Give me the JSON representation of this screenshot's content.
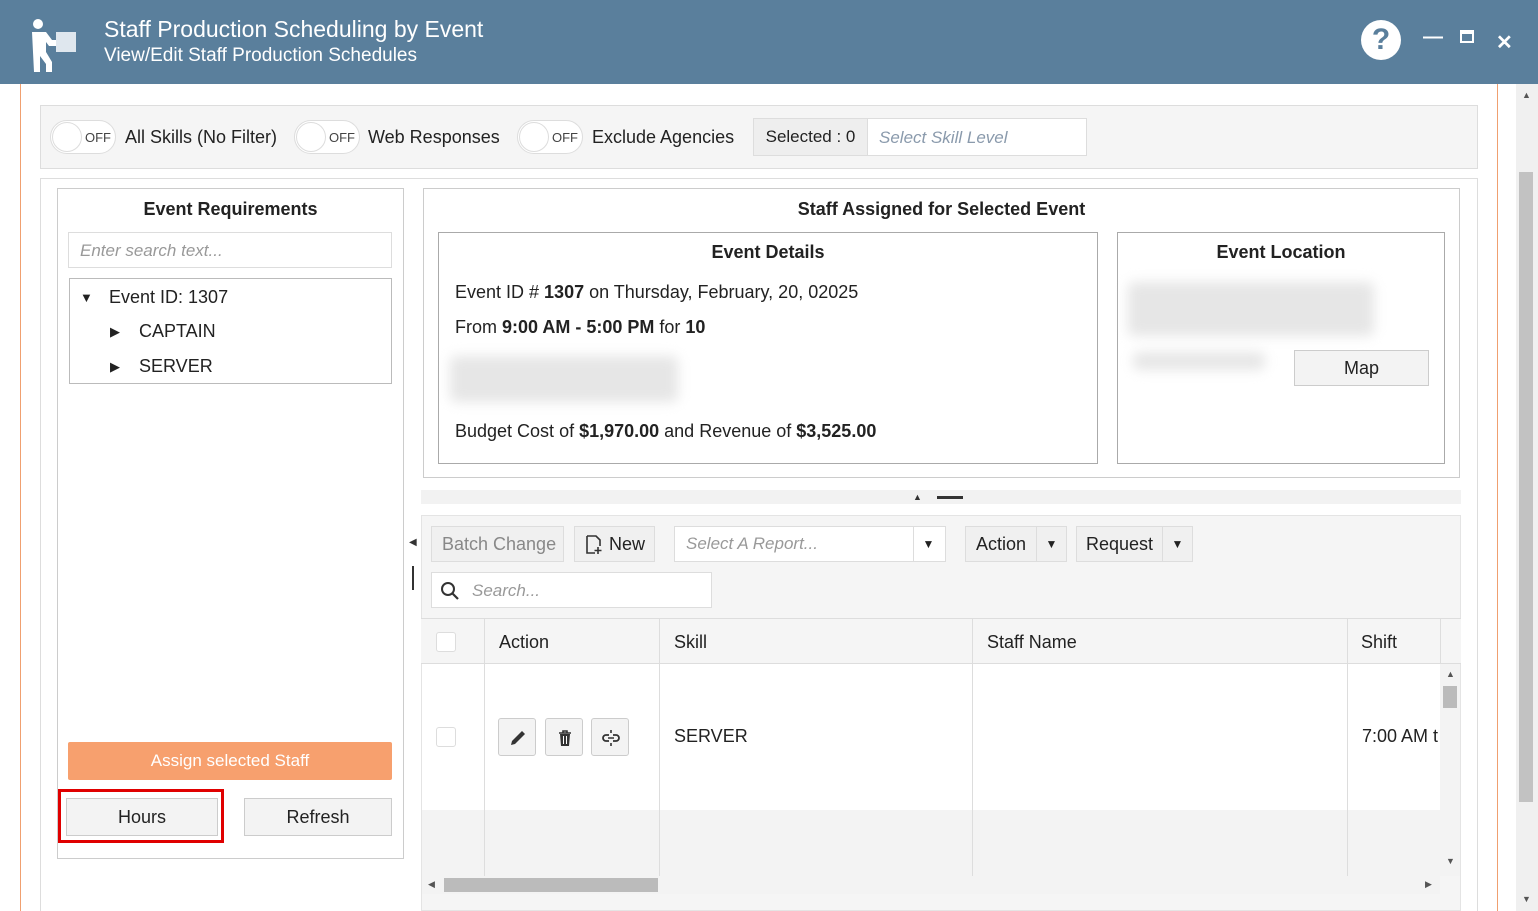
{
  "window": {
    "title": "Staff Production Scheduling by Event",
    "subtitle": "View/Edit Staff Production Schedules",
    "help_label": "?",
    "close_glyph": "✕",
    "min_glyph": "—",
    "header_color": "#5a7f9c"
  },
  "filters": {
    "toggle_off_text": "OFF",
    "all_skills_label": "All Skills (No Filter)",
    "web_responses_label": "Web Responses",
    "exclude_agencies_label": "Exclude Agencies",
    "selected_label": "Selected : 0",
    "skill_level_placeholder": "Select Skill Level"
  },
  "event_requirements": {
    "title": "Event Requirements",
    "search_placeholder": "Enter search text...",
    "tree": {
      "root": "Event ID: 1307",
      "children": [
        "CAPTAIN",
        "SERVER"
      ]
    },
    "assign_button": "Assign selected Staff",
    "hours_button": "Hours",
    "refresh_button": "Refresh",
    "assign_color": "#f7a06e"
  },
  "staff_assigned": {
    "title": "Staff Assigned for Selected Event",
    "event_details": {
      "title": "Event Details",
      "line1_a": "Event ID # ",
      "line1_id": "1307",
      "line1_b": " on Thursday, February, 20, 02025",
      "line2_a": "From ",
      "line2_time": "9:00 AM - 5:00 PM",
      "line2_b": " for ",
      "line2_count": "10",
      "line3_a": "Budget Cost of ",
      "line3_cost": "$1,970.00",
      "line3_b": " and Revenue of ",
      "line3_revenue": "$3,525.00"
    },
    "event_location": {
      "title": "Event Location",
      "map_button": "Map"
    }
  },
  "grid_toolbar": {
    "batch_change": "Batch Change",
    "new": "New",
    "report_placeholder": "Select A Report...",
    "action": "Action",
    "request": "Request",
    "search_placeholder": "Search..."
  },
  "grid": {
    "columns": [
      "Action",
      "Skill",
      "Staff Name",
      "Shift"
    ],
    "rows": [
      {
        "skill": "SERVER",
        "staff_name": "",
        "shift": "7:00 AM t"
      }
    ],
    "row_icons": [
      "pencil-icon",
      "trash-icon",
      "unlink-icon"
    ]
  }
}
